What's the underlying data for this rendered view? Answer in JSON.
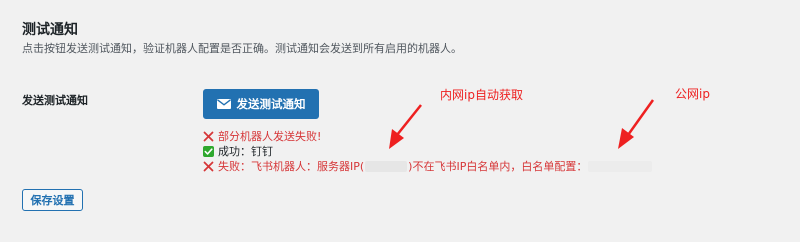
{
  "section": {
    "title": "测试通知",
    "description": "点击按钮发送测试通知，验证机器人配置是否正确。测试通知会发送到所有启用的机器人。"
  },
  "test_row": {
    "label": "发送测试通知",
    "button_label": "发送测试通知",
    "button_icon": "envelope-icon"
  },
  "results": [
    {
      "status": "fail",
      "icon": "x-icon",
      "text": "部分机器人发送失败!"
    },
    {
      "status": "success",
      "icon": "check-icon",
      "text": "成功：钉钉"
    },
    {
      "status": "fail",
      "icon": "x-icon",
      "text_before": "失败：飞书机器人：服务器IP(",
      "text_middle": ")不在飞书IP白名单内，白名单配置："
    }
  ],
  "save_button_label": "保存设置",
  "annotations": {
    "internal_ip": "内网ip自动获取",
    "public_ip": "公网ip"
  },
  "colors": {
    "primary": "#2271b1",
    "error": "#d63638",
    "success": "#2ea82e",
    "annotation": "#ee2020",
    "background": "#f1f1f1"
  }
}
